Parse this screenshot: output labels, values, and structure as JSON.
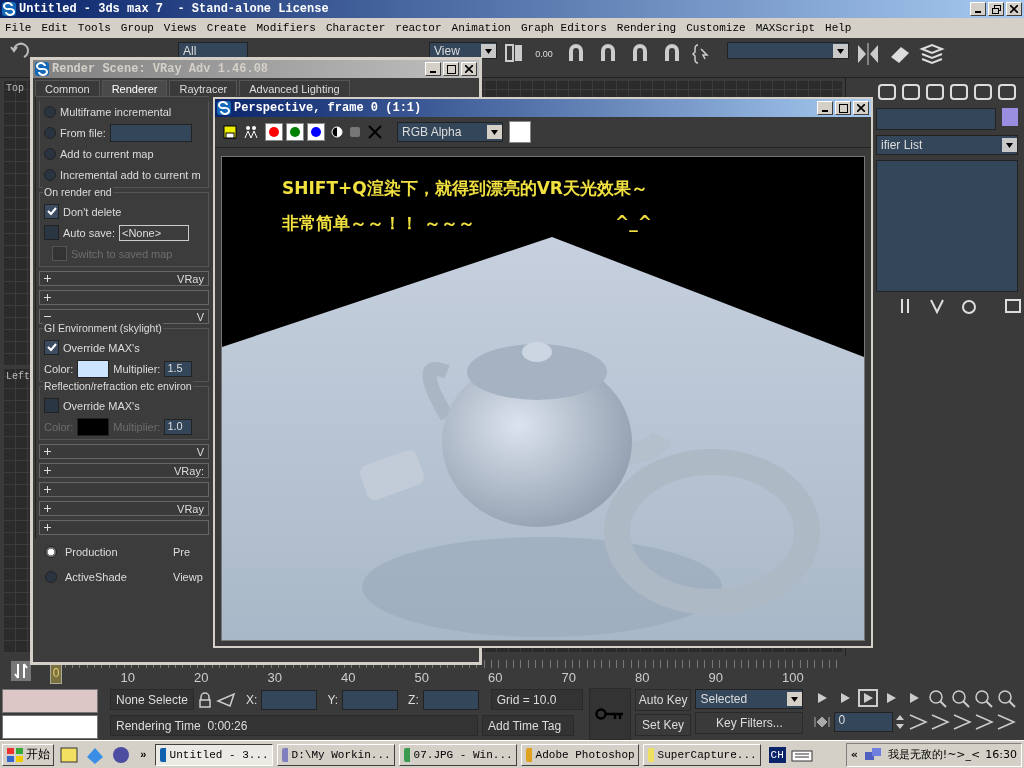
{
  "window": {
    "title": "Untitled - 3ds max 7  - Stand-alone License"
  },
  "menu": [
    "File",
    "Edit",
    "Tools",
    "Group",
    "Views",
    "Create",
    "Modifiers",
    "Character",
    "reactor",
    "Animation",
    "Graph Editors",
    "Rendering",
    "Customize",
    "MAXScript",
    "Help"
  ],
  "toolbar": {
    "selection_filter": "All",
    "reference_coord": "View",
    "spinner_snap": "0.00"
  },
  "viewports": [
    {
      "label": "Top"
    },
    {
      "label": "Left"
    }
  ],
  "command_panel": {
    "modifier_list": "ifier List"
  },
  "render_scene": {
    "title": "Render Scene: VRay Adv 1.46.08",
    "tabs": [
      {
        "label": "Common",
        "selected": false
      },
      {
        "label": "Renderer",
        "selected": true
      },
      {
        "label": "Raytracer",
        "selected": false
      },
      {
        "label": "Advanced Lighting",
        "selected": false
      }
    ],
    "modes": [
      {
        "label": "Multiframe incremental",
        "selected": false
      },
      {
        "label": "From file:",
        "selected": false,
        "kind": "file"
      },
      {
        "label": "Add to current map",
        "selected": false
      },
      {
        "label": "Incremental add to current m",
        "selected": false
      }
    ],
    "on_render_end": {
      "title": "On render end",
      "options": [
        {
          "label": "Don't delete",
          "checked": true,
          "disabled": false
        },
        {
          "label": "Auto save:",
          "checked": false,
          "disabled": false,
          "value": "<None>"
        },
        {
          "label": "Switch to saved map",
          "checked": false,
          "disabled": true
        }
      ]
    },
    "rollouts_top": [
      {
        "title": "VRay",
        "expanded": false
      },
      {
        "expanded": false
      },
      {
        "title": "V",
        "expanded": true
      }
    ],
    "environments": [
      {
        "title": "GI Environment (skylight)",
        "override_label": "Override MAX's",
        "checked": true,
        "disabled": false,
        "color_label": "Color:",
        "color": "#cce4ff",
        "multiplier_label": "Multiplier:",
        "multiplier": "1.5"
      },
      {
        "title": "Reflection/refraction etc environ",
        "override_label": "Override MAX's",
        "checked": false,
        "disabled": true,
        "color_label": "Color:",
        "color": "#000000",
        "multiplier_label": "Multiplier:",
        "multiplier": "1.0"
      }
    ],
    "rollouts_bottom": [
      {
        "title": "V",
        "expanded": false
      },
      {
        "title": "VRay:",
        "expanded": false
      },
      {
        "expanded": false
      },
      {
        "title": "VRay",
        "expanded": false
      },
      {
        "expanded": false
      }
    ],
    "render_modes": [
      {
        "label": "Production",
        "selected": true,
        "preset": "Pre"
      },
      {
        "label": "ActiveShade",
        "selected": false,
        "preset": "Viewp"
      }
    ]
  },
  "frame_buffer": {
    "title": "Perspective, frame 0 (1:1)",
    "channels": [
      {
        "color": "#ff0000",
        "on": true
      },
      {
        "color": "#008000",
        "on": true
      },
      {
        "color": "#0000ff",
        "on": true
      }
    ],
    "channel_select": "RGB Alpha",
    "caption": [
      "SHIFT+Q渲染下，就得到漂亮的VR天光效果～",
      "非常简单～～！！ ～～～",
      "^_^"
    ]
  },
  "timeline": {
    "frame_slider": "0",
    "ticks": [
      "10",
      "20",
      "30",
      "40",
      "50",
      "60",
      "70",
      "80",
      "90",
      "100"
    ]
  },
  "status": {
    "selection": "None Selecte",
    "x_label": "X:",
    "y_label": "Y:",
    "z_label": "Z:",
    "grid": "Grid = 10.0",
    "prompt": "Rendering Time  0:00:26",
    "add_time_tag": "Add Time Tag",
    "auto_key": "Auto Key",
    "key_mode": "Selected",
    "set_key": "Set Key",
    "key_filters": "Key Filters...",
    "current_frame": "0"
  },
  "taskbar": {
    "start": "开始",
    "more": "»",
    "tasks": [
      {
        "label": "Untitled - 3...",
        "selected": true
      },
      {
        "label": "D:\\My Workin...",
        "selected": false
      },
      {
        "label": "07.JPG - Win...",
        "selected": false
      },
      {
        "label": "Adobe Photoshop",
        "selected": false
      },
      {
        "label": "SuperCapture...",
        "selected": false
      }
    ],
    "language": "CH",
    "tray_expand": "«",
    "tray_text": "我是无敌的!~>_<",
    "clock": "16:30"
  }
}
